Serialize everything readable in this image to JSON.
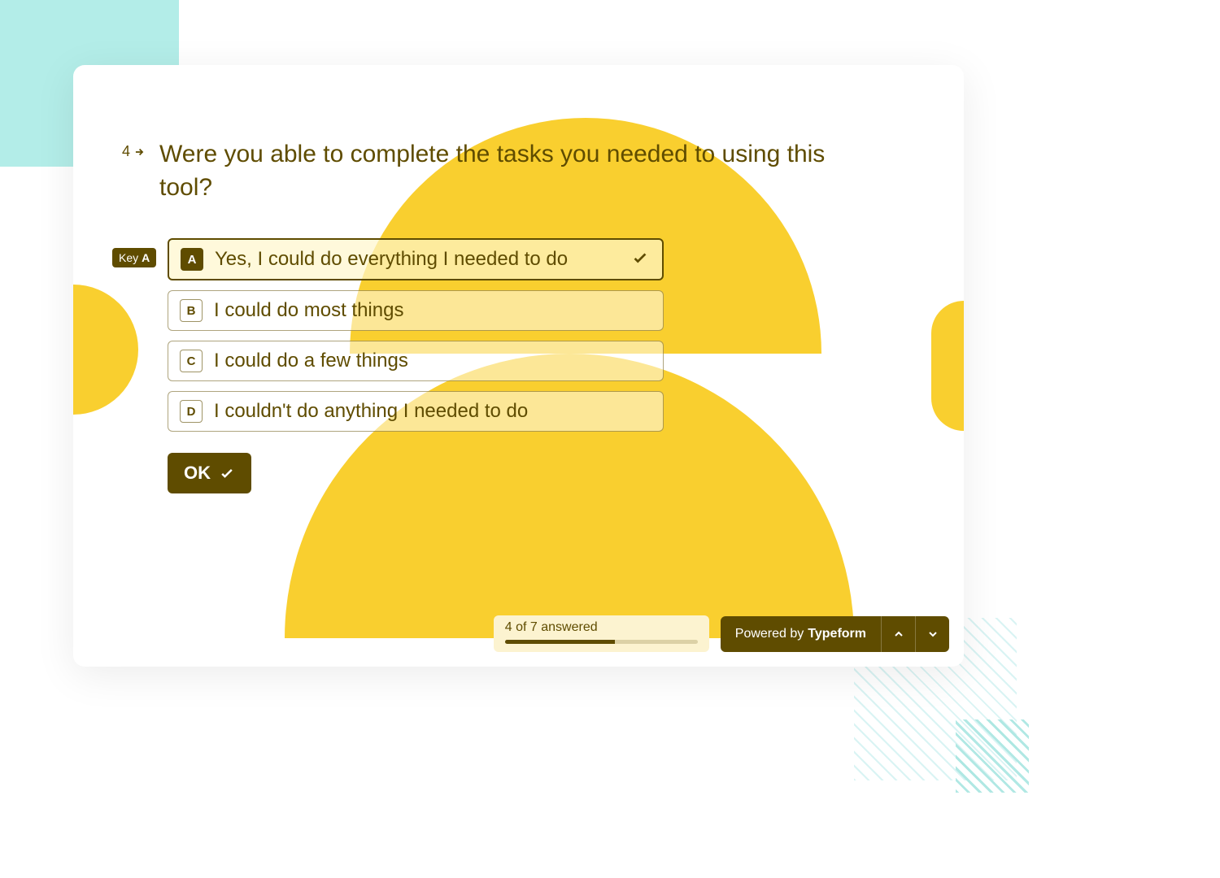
{
  "question": {
    "number": "4",
    "text": "Were you able to complete the tasks you needed to using this tool?",
    "key_hint_prefix": "Key",
    "key_hint_letter": "A",
    "options": [
      {
        "key": "A",
        "label": "Yes, I could do everything I needed to do",
        "selected": true
      },
      {
        "key": "B",
        "label": "I could do most things",
        "selected": false
      },
      {
        "key": "C",
        "label": "I could do a few things",
        "selected": false
      },
      {
        "key": "D",
        "label": "I couldn't do anything I needed to do",
        "selected": false
      }
    ],
    "ok_label": "OK"
  },
  "footer": {
    "progress_text": "4 of 7 answered",
    "progress_current": 4,
    "progress_total": 7,
    "powered_prefix": "Powered by",
    "powered_brand": "Typeform"
  }
}
